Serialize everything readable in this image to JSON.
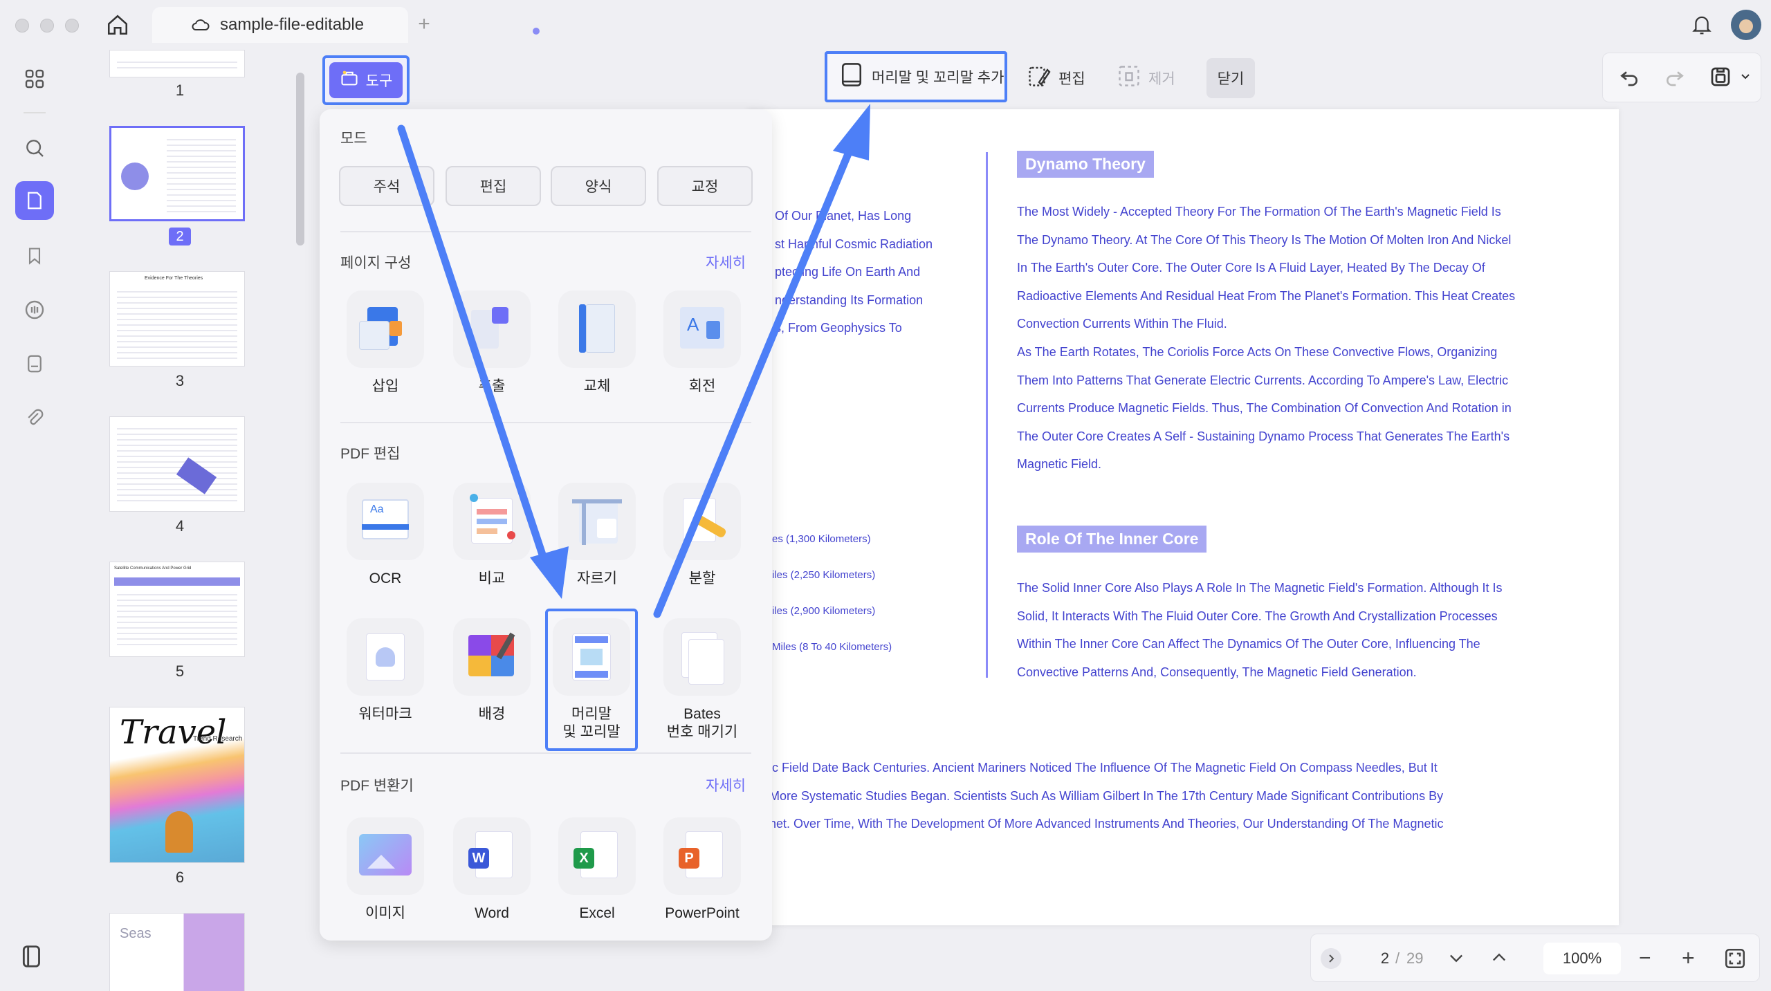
{
  "titlebar": {
    "tab_title": "sample-file-editable",
    "icons": [
      "home-icon",
      "cloud-icon",
      "plus-icon",
      "bell-icon",
      "avatar"
    ]
  },
  "toolbar": {
    "tool_label": "도구",
    "header_footer_add": "머리말 및 꼬리말 추가",
    "edit": "편집",
    "remove": "제거",
    "close": "닫기"
  },
  "thumbnails": {
    "pages": [
      "1",
      "2",
      "3",
      "4",
      "5",
      "6"
    ],
    "selected": "2",
    "page3_title": "Evidence For The Theories",
    "page5_title": "Satellite Communications And Power Grid",
    "page6_title": "Travel",
    "page6_subtitle": "Trend Research",
    "page7_title": "Seas"
  },
  "panel": {
    "mode_title": "모드",
    "modes": [
      "주석",
      "편집",
      "양식",
      "교정"
    ],
    "page_section_title": "페이지 구성",
    "more": "자세히",
    "page_tools": [
      "삽입",
      "추출",
      "교체",
      "회전"
    ],
    "pdf_edit_title": "PDF 편집",
    "edit_tools": [
      "OCR",
      "비교",
      "자르기",
      "분할"
    ],
    "edit_tools_row2": [
      "워터마크",
      "배경",
      "머리말\n및 꼬리말",
      "Bates\n번호 매기기"
    ],
    "convert_title": "PDF 변환기",
    "convert_tools": [
      "이미지",
      "Word",
      "Excel",
      "PowerPoint"
    ]
  },
  "document": {
    "left_fragments": [
      "Of Our Planet, Has Long",
      "st Harmful Cosmic Radiation",
      "ptecting Life On Earth And",
      "nderstanding Its Formation",
      "s, From Geophysics To"
    ],
    "dynamo_heading": "Dynamo Theory",
    "dynamo_lines": [
      "The Most Widely - Accepted Theory For The Formation Of The Earth's Magnetic Field Is",
      "The Dynamo Theory. At The Core Of This Theory Is The Motion Of Molten Iron And Nickel",
      "In The Earth's Outer Core. The Outer Core Is A Fluid Layer, Heated By The Decay Of",
      "Radioactive Elements And Residual Heat From The Planet's Formation. This Heat Creates",
      "Convection Currents Within The Fluid.",
      "As The Earth Rotates, The Coriolis Force Acts On These Convective Flows, Organizing",
      "Them Into Patterns That Generate Electric Currents. According To Ampere's Law, Electric",
      "Currents Produce Magnetic Fields. Thus, The Combination Of Convection And Rotation in",
      "The Outer Core Creates A Self - Sustaining Dynamo Process That Generates The Earth's",
      "Magnetic Field."
    ],
    "mid_fragments": [
      "es (1,300 Kilometers)",
      "iles (2,250 Kilometers)",
      "iles (2,900 Kilometers)",
      "Miles (8 To 40 Kilometers)"
    ],
    "inner_core_heading": "Role Of The Inner Core",
    "inner_core_lines": [
      "The Solid Inner Core Also Plays A Role In The Magnetic Field's Formation. Although It Is",
      "Solid, It Interacts With The Fluid Outer Core. The Growth And Crystallization Processes",
      "Within The Inner Core Can Affect The Dynamics Of The Outer Core, Influencing The",
      "Convective Patterns And, Consequently, The Magnetic Field Generation."
    ],
    "bottom_lines": [
      "ic Field Date Back Centuries. Ancient Mariners Noticed The Influence Of The Magnetic Field On Compass Needles, But It",
      "More Systematic Studies Began. Scientists Such As William Gilbert In The 17th Century Made Significant Contributions By",
      "net. Over Time, With The Development Of More Advanced Instruments And Theories, Our Understanding Of The Magnetic"
    ]
  },
  "bottom_nav": {
    "current_page": "2",
    "separator": "/",
    "total_pages": "29",
    "zoom": "100%"
  },
  "colors": {
    "accent": "#6e6ef7",
    "highlight": "#4d7ff7",
    "doc_text": "#4343cf"
  }
}
